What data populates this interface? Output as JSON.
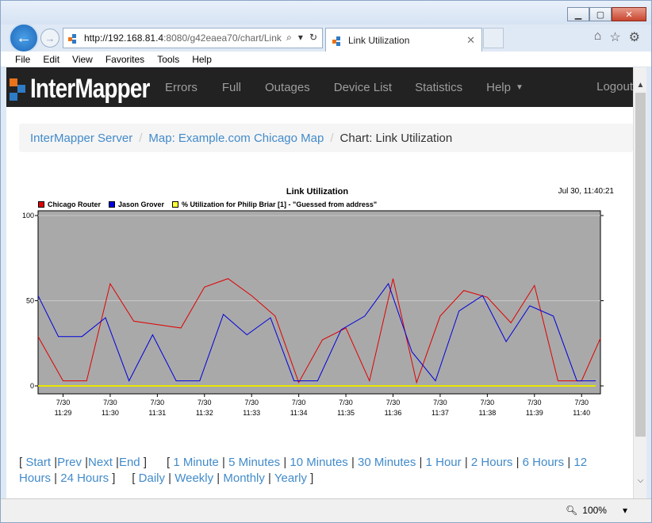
{
  "browser": {
    "address_host": "http://192.168.81.4",
    "address_rest": ":8080/g42eaea70/chart/Link",
    "tab_title": "Link Utilization",
    "menu": [
      "File",
      "Edit",
      "View",
      "Favorites",
      "Tools",
      "Help"
    ],
    "zoom": "100%"
  },
  "app": {
    "logo_text": "InterMapper",
    "nav": [
      "Errors",
      "Full",
      "Outages",
      "Device List",
      "Statistics",
      "Help"
    ],
    "logout": "Logout"
  },
  "breadcrumb": {
    "server": "InterMapper Server",
    "map": "Map: Example.com Chicago Map",
    "current": "Chart: Link Utilization"
  },
  "chart_data": {
    "type": "line",
    "title": "Link Utilization",
    "timestamp": "Jul 30, 11:40:21",
    "ylim": [
      0,
      100
    ],
    "yticks": [
      0,
      50,
      100
    ],
    "grid": true,
    "legend_position": "top-left",
    "plot_bg": "#a9a9a9",
    "x_labels": [
      {
        "date": "7/30",
        "time": "11:29"
      },
      {
        "date": "7/30",
        "time": "11:30"
      },
      {
        "date": "7/30",
        "time": "11:31"
      },
      {
        "date": "7/30",
        "time": "11:32"
      },
      {
        "date": "7/30",
        "time": "11:33"
      },
      {
        "date": "7/30",
        "time": "11:34"
      },
      {
        "date": "7/30",
        "time": "11:35"
      },
      {
        "date": "7/30",
        "time": "11:36"
      },
      {
        "date": "7/30",
        "time": "11:37"
      },
      {
        "date": "7/30",
        "time": "11:38"
      },
      {
        "date": "7/30",
        "time": "11:39"
      },
      {
        "date": "7/30",
        "time": "11:40"
      }
    ],
    "x_min": 11.47,
    "x_max": 23.4,
    "series": [
      {
        "name": "Chicago Router",
        "color": "#e00000",
        "swatch": "#e00000",
        "x": [
          11.47,
          12.0,
          12.5,
          13.0,
          13.5,
          14.0,
          14.5,
          15.0,
          15.5,
          16.0,
          16.5,
          17.0,
          17.5,
          18.0,
          18.5,
          19.0,
          19.5,
          20.0,
          20.5,
          21.0,
          21.5,
          22.0,
          22.5,
          23.0,
          23.4
        ],
        "y": [
          29,
          3,
          3,
          60,
          38,
          36,
          34,
          58,
          63,
          53,
          41,
          2,
          27,
          34,
          3,
          63,
          2,
          41,
          56,
          52,
          37,
          59,
          3,
          3,
          28
        ]
      },
      {
        "name": "Jason Grover",
        "color": "#0000dd",
        "swatch": "#0000dd",
        "x": [
          11.47,
          11.9,
          12.4,
          12.9,
          13.4,
          13.9,
          14.4,
          14.9,
          15.4,
          15.9,
          16.4,
          16.9,
          17.4,
          17.9,
          18.4,
          18.9,
          19.4,
          19.9,
          20.4,
          20.9,
          21.4,
          21.9,
          22.4,
          22.9,
          23.3
        ],
        "y": [
          53,
          29,
          29,
          40,
          3,
          30,
          3,
          3,
          42,
          30,
          40,
          3,
          3,
          33,
          41,
          60,
          20,
          3,
          44,
          53,
          26,
          47,
          41,
          3,
          3
        ]
      },
      {
        "name": "% Utilization for Philip Briar [1] - \"Guessed from address\"",
        "color": "#e6e600",
        "swatch": "#ffff33",
        "x": [
          11.47,
          23.3
        ],
        "y": [
          0,
          0
        ]
      }
    ]
  },
  "timelinks": {
    "nav": [
      "Start",
      "Prev",
      "Next",
      "End"
    ],
    "ranges": [
      "1 Minute",
      "5 Minutes",
      "10 Minutes",
      "30 Minutes",
      "1 Hour",
      "2 Hours",
      "6 Hours",
      "12 Hours",
      "24 Hours"
    ],
    "periods": [
      "Daily",
      "Weekly",
      "Monthly",
      "Yearly"
    ]
  }
}
